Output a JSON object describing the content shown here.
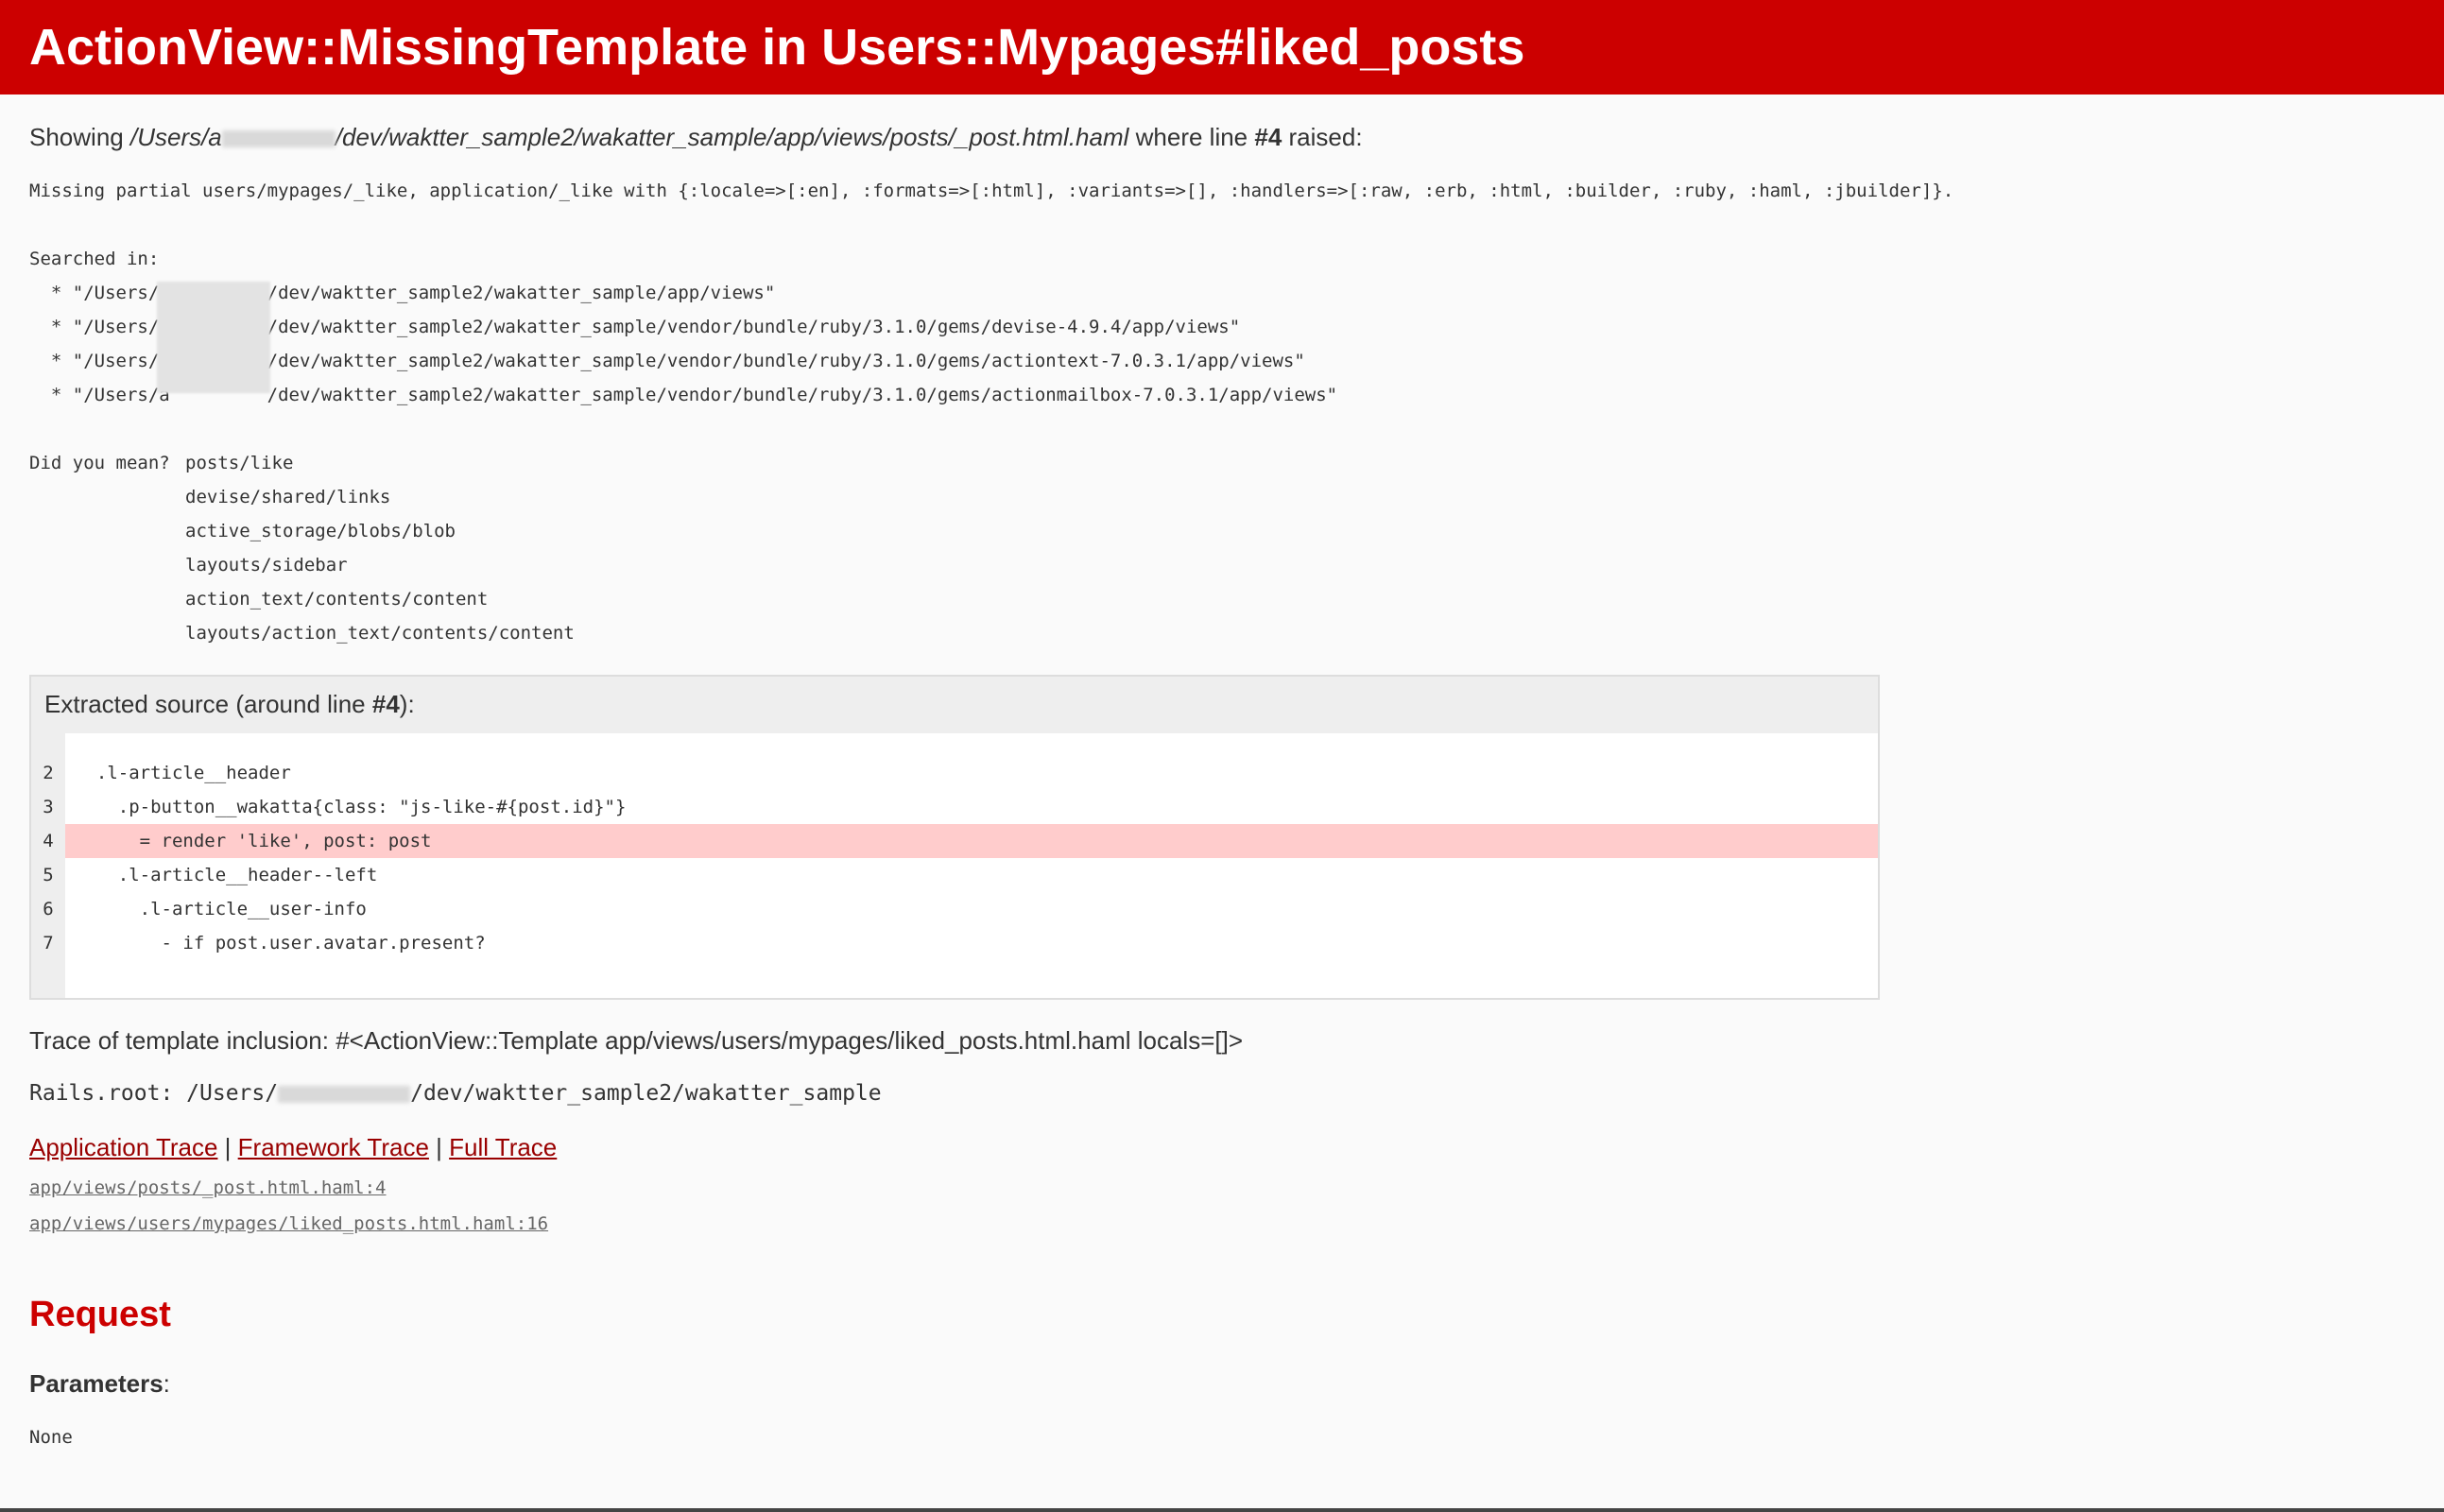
{
  "header": {
    "title": "ActionView::MissingTemplate in Users::Mypages#liked_posts"
  },
  "showing": {
    "prefix": "Showing ",
    "path_start": "/Users/a",
    "path_end": "/dev/waktter_sample2/wakatter_sample/app/views/posts/_post.html.haml",
    "mid": " where line ",
    "line": "#4",
    "suffix": " raised:"
  },
  "message": "Missing partial users/mypages/_like, application/_like with {:locale=>[:en], :formats=>[:html], :variants=>[], :handlers=>[:raw, :erb, :html, :builder, :ruby, :haml, :jbuilder]}.",
  "searched": {
    "label": "Searched in:",
    "paths": [
      "  * \"/Users/a         /dev/waktter_sample2/wakatter_sample/app/views\"",
      "  * \"/Users/a         /dev/waktter_sample2/wakatter_sample/vendor/bundle/ruby/3.1.0/gems/devise-4.9.4/app/views\"",
      "  * \"/Users/a         /dev/waktter_sample2/wakatter_sample/vendor/bundle/ruby/3.1.0/gems/actiontext-7.0.3.1/app/views\"",
      "  * \"/Users/a         /dev/waktter_sample2/wakatter_sample/vendor/bundle/ruby/3.1.0/gems/actionmailbox-7.0.3.1/app/views\""
    ]
  },
  "did_you_mean": {
    "label": "Did you mean?",
    "options": [
      "posts/like",
      "devise/shared/links",
      "active_storage/blobs/blob",
      "layouts/sidebar",
      "action_text/contents/content",
      "layouts/action_text/contents/content"
    ]
  },
  "source": {
    "title_prefix": "Extracted source (around line ",
    "title_line": "#4",
    "title_suffix": "):",
    "lines": [
      {
        "num": "2",
        "text": "  .l-article__header"
      },
      {
        "num": "3",
        "text": "    .p-button__wakatta{class: \"js-like-#{post.id}\"}"
      },
      {
        "num": "4",
        "text": "      = render 'like', post: post"
      },
      {
        "num": "5",
        "text": "    .l-article__header--left"
      },
      {
        "num": "6",
        "text": "      .l-article__user-info"
      },
      {
        "num": "7",
        "text": "        - if post.user.avatar.present?"
      }
    ]
  },
  "trace_inclusion": "Trace of template inclusion: #<ActionView::Template app/views/users/mypages/liked_posts.html.haml locals=[]>",
  "rails_root": {
    "prefix": "Rails.root: /Users/",
    "suffix": "/dev/waktter_sample2/wakatter_sample"
  },
  "trace_tabs": {
    "application": "Application Trace",
    "framework": "Framework Trace",
    "full": "Full Trace",
    "sep": " | "
  },
  "trace_lines": [
    "app/views/posts/_post.html.haml:4",
    "app/views/users/mypages/liked_posts.html.haml:16"
  ],
  "request": {
    "heading": "Request",
    "params_label": "Parameters",
    "params_colon": ":",
    "params_value": "None"
  },
  "colors": {
    "header_bg": "#cc0000",
    "link": "#990000",
    "highlight": "#ffcccc"
  }
}
